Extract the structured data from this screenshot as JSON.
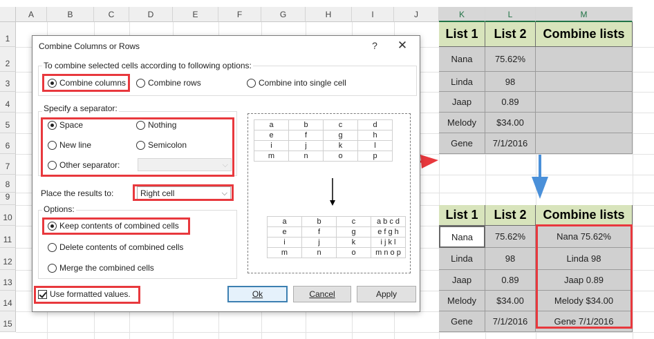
{
  "spreadsheet": {
    "columns": [
      "A",
      "B",
      "C",
      "D",
      "E",
      "F",
      "G",
      "H",
      "I",
      "J",
      "K",
      "L",
      "M"
    ],
    "rows": [
      "1",
      "2",
      "3",
      "4",
      "5",
      "6",
      "7",
      "8",
      "9",
      "10",
      "11",
      "12",
      "13",
      "14",
      "15"
    ],
    "top_table": {
      "headers": [
        "List 1",
        "List 2",
        "Combine lists"
      ],
      "rows": [
        [
          "Nana",
          "75.62%",
          ""
        ],
        [
          "Linda",
          "98",
          ""
        ],
        [
          "Jaap",
          "0.89",
          ""
        ],
        [
          "Melody",
          "$34.00",
          ""
        ],
        [
          "Gene",
          "7/1/2016",
          ""
        ]
      ]
    },
    "bottom_table": {
      "headers": [
        "List 1",
        "List 2",
        "Combine lists"
      ],
      "rows": [
        [
          "Nana",
          "75.62%",
          "Nana 75.62%"
        ],
        [
          "Linda",
          "98",
          "Linda 98"
        ],
        [
          "Jaap",
          "0.89",
          "Jaap 0.89"
        ],
        [
          "Melody",
          "$34.00",
          "Melody $34.00"
        ],
        [
          "Gene",
          "7/1/2016",
          "Gene 7/1/2016"
        ]
      ]
    },
    "colors": {
      "header_fill": "#d8e4bc",
      "cell_fill": "#d0d0d0",
      "highlight": "#e8383d",
      "arrow_blue": "#4a90d9"
    }
  },
  "dialog": {
    "title": "Combine Columns or Rows",
    "help": "?",
    "close": "✕",
    "combine_group": {
      "label": "To combine selected cells according to following options:",
      "options": [
        "Combine columns",
        "Combine rows",
        "Combine into single cell"
      ],
      "selected": "Combine columns"
    },
    "separator_group": {
      "label": "Specify a separator:",
      "options": [
        "Space",
        "Nothing",
        "New line",
        "Semicolon",
        "Other separator:"
      ],
      "selected": "Space",
      "other_value": ""
    },
    "place_results": {
      "label": "Place the results to:",
      "value": "Right cell"
    },
    "options_group": {
      "label": "Options:",
      "options": [
        "Keep contents of combined cells",
        "Delete contents of combined cells",
        "Merge the combined cells"
      ],
      "selected": "Keep contents of combined cells"
    },
    "use_formatted": {
      "label": "Use formatted values.",
      "checked": true
    },
    "buttons": {
      "ok": "Ok",
      "cancel": "Cancel",
      "apply": "Apply"
    },
    "preview": {
      "before": [
        [
          "a",
          "b",
          "c",
          "d"
        ],
        [
          "e",
          "f",
          "g",
          "h"
        ],
        [
          "i",
          "j",
          "k",
          "l"
        ],
        [
          "m",
          "n",
          "o",
          "p"
        ]
      ],
      "after": [
        [
          "a",
          "b",
          "c",
          "a b c d"
        ],
        [
          "e",
          "f",
          "g",
          "e f g h"
        ],
        [
          "i",
          "j",
          "k",
          "i j k l"
        ],
        [
          "m",
          "n",
          "o",
          "m n o p"
        ]
      ]
    }
  }
}
